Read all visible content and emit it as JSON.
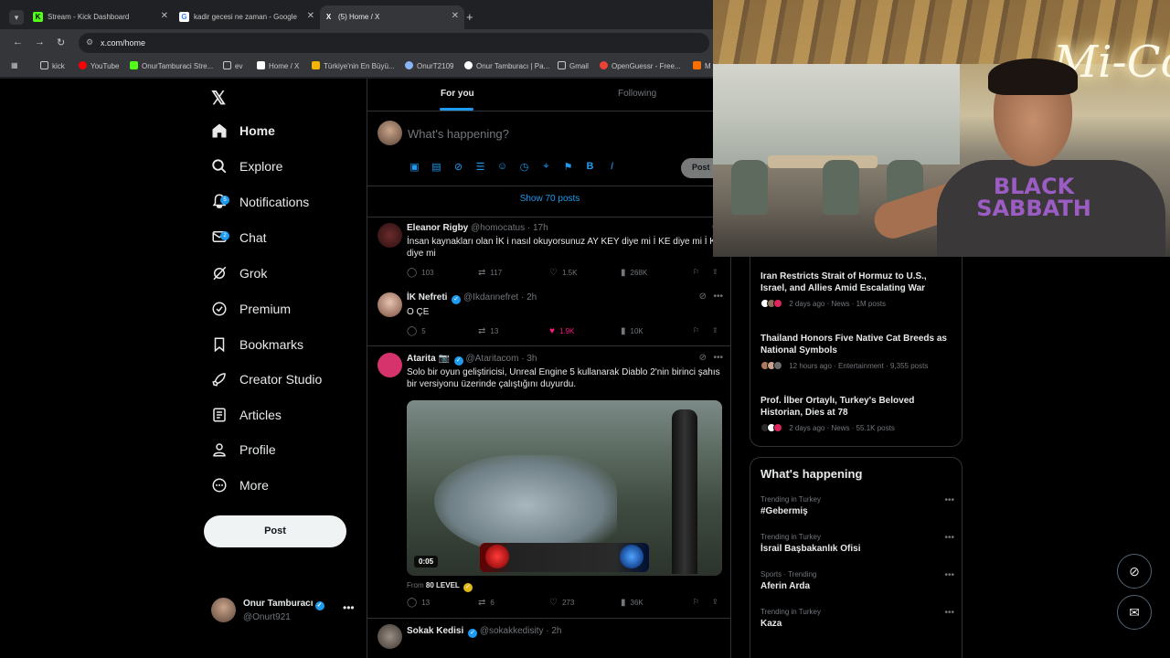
{
  "browser": {
    "tabs": [
      {
        "title": "Stream - Kick Dashboard",
        "favicon": "K",
        "color": "#53fc18"
      },
      {
        "title": "kadir gecesi ne zaman - Google",
        "favicon": "G",
        "color": "#ffffff"
      },
      {
        "title": "(5) Home / X",
        "favicon": "X",
        "color": "#000000"
      }
    ],
    "url": "x.com/home",
    "bookmarks": [
      {
        "label": "kick",
        "icon": "folder-icon",
        "color": "#c7c7c7"
      },
      {
        "label": "YouTube",
        "icon": "youtube-icon",
        "color": "#ff0000"
      },
      {
        "label": "OnurTamburaci Stre...",
        "icon": "kick-icon",
        "color": "#53fc18"
      },
      {
        "label": "ev",
        "icon": "folder-icon",
        "color": "#c7c7c7"
      },
      {
        "label": "Home / X",
        "icon": "x-icon",
        "color": "#ffffff"
      },
      {
        "label": "Türkiye'nin En Büyü...",
        "icon": "crown-icon",
        "color": "#f4b400"
      },
      {
        "label": "OnurT2109",
        "icon": "globe-icon",
        "color": "#8ab4f8"
      },
      {
        "label": "Onur Tamburacı | Pa...",
        "icon": "patreon-icon",
        "color": "#ffffff"
      },
      {
        "label": "Gmail",
        "icon": "folder-icon",
        "color": "#c7c7c7"
      },
      {
        "label": "OpenGuessr - Free...",
        "icon": "pin-icon",
        "color": "#ea4335"
      },
      {
        "label": "M",
        "icon": "app-icon",
        "color": "#ff6f00"
      }
    ]
  },
  "nav": {
    "items": [
      {
        "label": "Home",
        "icon": "home-icon",
        "badge": ""
      },
      {
        "label": "Explore",
        "icon": "search-icon",
        "badge": ""
      },
      {
        "label": "Notifications",
        "icon": "bell-icon",
        "badge": "5"
      },
      {
        "label": "Chat",
        "icon": "mail-icon",
        "badge": "2"
      },
      {
        "label": "Grok",
        "icon": "grok-icon",
        "badge": ""
      },
      {
        "label": "Premium",
        "icon": "premium-icon",
        "badge": ""
      },
      {
        "label": "Bookmarks",
        "icon": "bookmark-icon",
        "badge": ""
      },
      {
        "label": "Creator Studio",
        "icon": "rocket-icon",
        "badge": ""
      },
      {
        "label": "Articles",
        "icon": "article-icon",
        "badge": ""
      },
      {
        "label": "Profile",
        "icon": "person-icon",
        "badge": ""
      },
      {
        "label": "More",
        "icon": "more-circle-icon",
        "badge": ""
      }
    ],
    "post_label": "Post",
    "account": {
      "name": "Onur Tamburacı",
      "handle": "@Onurt921"
    }
  },
  "timeline": {
    "tab_for_you": "For you",
    "tab_following": "Following",
    "compose_placeholder": "What's happening?",
    "compose_post": "Post",
    "show_posts": "Show 70 posts",
    "tweets": [
      {
        "name": "Eleanor Rigby",
        "handle": "@homocatus",
        "time": "17h",
        "text": "İnsan kaynakları olan İK i nasıl okuyorsunuz AY KEY diye mi İ KE diye mi İ K diye mi",
        "replies": "103",
        "reposts": "117",
        "likes": "1.5K",
        "views": "268K"
      },
      {
        "name": "İK Nefreti",
        "handle": "@Ikdannefret",
        "time": "2h",
        "text": "O ÇE",
        "replies": "5",
        "reposts": "13",
        "likes": "1.9K",
        "views": "10K"
      },
      {
        "name": "Atarita 📷",
        "handle": "@Ataritacom",
        "time": "3h",
        "text": "Solo bir oyun geliştiricisi, Unreal Engine 5 kullanarak Diablo 2'nin birinci şahıs bir versiyonu üzerinde çalıştığını duyurdu.",
        "duration": "0:05",
        "from_prefix": "From",
        "from": "80 LEVEL",
        "replies": "13",
        "reposts": "6",
        "likes": "273",
        "views": "36K"
      },
      {
        "name": "Sokak Kedisi",
        "handle": "@sokakkedisity",
        "time": "2h"
      }
    ]
  },
  "news": [
    {
      "title": "Iran Restricts Strait of Hormuz to U.S., Israel, and Allies Amid Escalating War",
      "meta": "2 days ago · News · 1M posts"
    },
    {
      "title": "Thailand Honors Five Native Cat Breeds as National Symbols",
      "meta": "12 hours ago · Entertainment · 9,355 posts"
    },
    {
      "title": "Prof. İlber Ortaylı, Turkey's Beloved Historian, Dies at 78",
      "meta": "2 days ago · News · 55.1K posts"
    }
  ],
  "trends": {
    "title": "What's happening",
    "items": [
      {
        "context": "Trending in Turkey",
        "name": "#Gebermiş"
      },
      {
        "context": "Trending in Turkey",
        "name": "İsrail Başbakanlık Ofisi"
      },
      {
        "context": "Sports · Trending",
        "name": "Aferin Arda"
      },
      {
        "context": "Trending in Turkey",
        "name": "Kaza"
      }
    ]
  },
  "webcam": {
    "neon_sign": "Mi-Co",
    "shirt_text": "BLACK SABBATH"
  },
  "colors": {
    "accent": "#1d9bf0",
    "like": "#f91880",
    "muted": "#71767b",
    "border": "#2f3336"
  }
}
